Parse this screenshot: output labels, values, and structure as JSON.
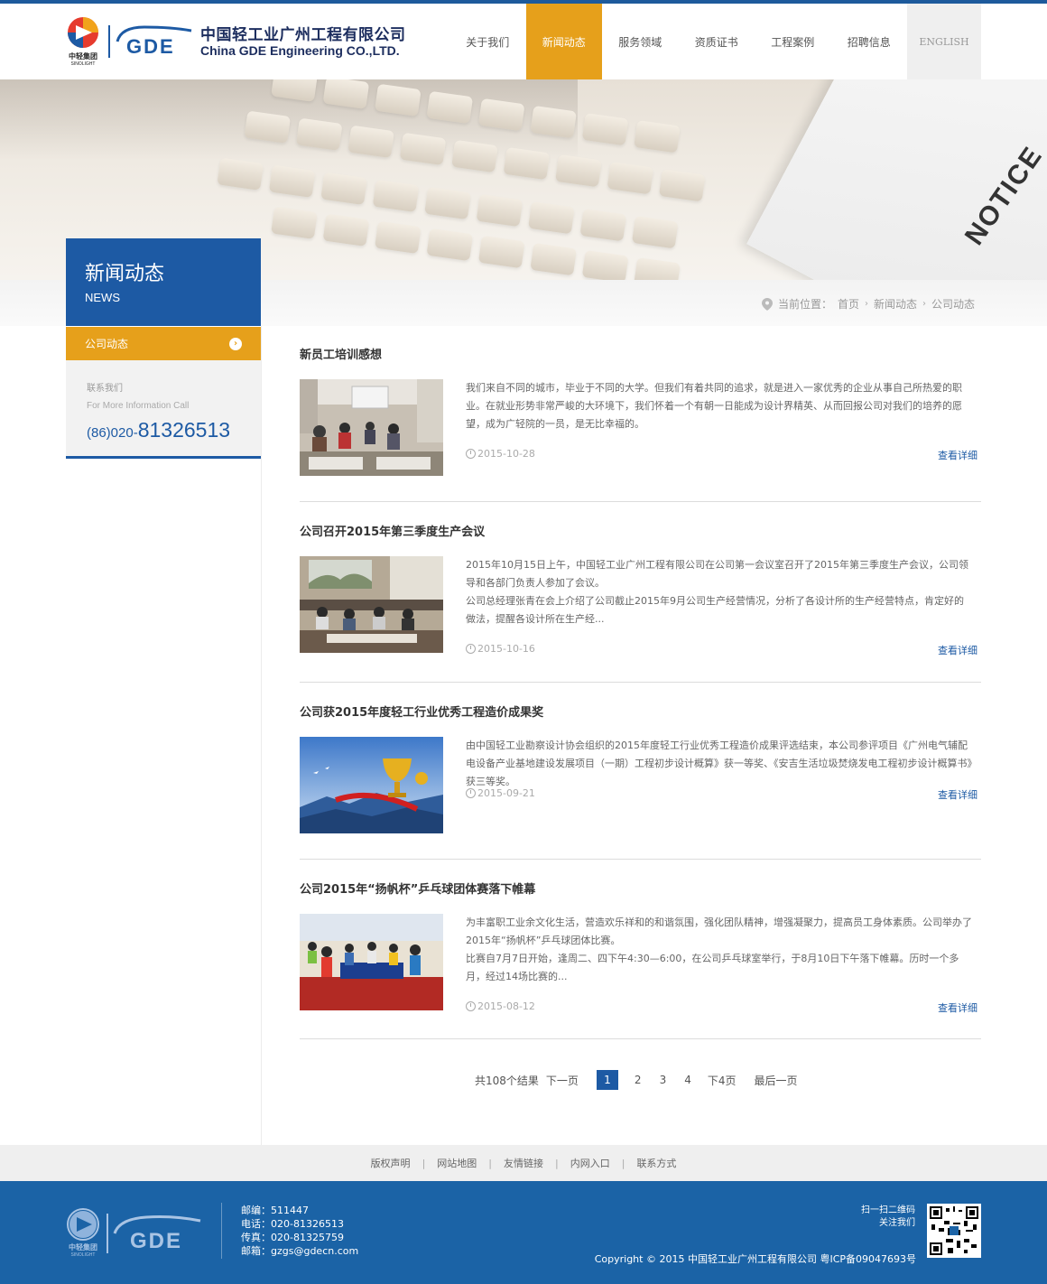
{
  "header": {
    "brand_group_cn": "中轻集团",
    "brand_group_en": "SINOLIGHT",
    "company_cn": "中国轻工业广州工程有限公司",
    "company_en": "China GDE Engineering CO.,LTD.",
    "logo_text": "GDE"
  },
  "nav": {
    "items": [
      {
        "label": "关于我们"
      },
      {
        "label": "新闻动态",
        "active": true
      },
      {
        "label": "服务领域"
      },
      {
        "label": "资质证书"
      },
      {
        "label": "工程案例"
      },
      {
        "label": "招聘信息"
      },
      {
        "label": "ENGLISH"
      }
    ]
  },
  "banner": {
    "notice_text": "NOTICE"
  },
  "breadcrumb": {
    "prefix": "当前位置：",
    "items": [
      "首页",
      "新闻动态",
      "公司动态"
    ]
  },
  "sidebar": {
    "title_cn": "新闻动态",
    "title_en": "NEWS",
    "menu_active": "公司动态",
    "contact_label": "联系我们",
    "contact_sub": "For More Information Call",
    "phone_prefix": "(86)020-",
    "phone_number": "81326513"
  },
  "news": [
    {
      "title": "新员工培训感想",
      "summary": "我们来自不同的城市，毕业于不同的大学。但我们有着共同的追求，就是进入一家优秀的企业从事自己所热爱的职业。在就业形势非常严峻的大环境下，我们怀着一个有朝一日能成为设计界精英、从而回报公司对我们的培养的愿望，成为广轻院的一员，是无比幸福的。",
      "date": "2015-10-28",
      "more": "查看详细"
    },
    {
      "title": "公司召开2015年第三季度生产会议",
      "summary": "2015年10月15日上午，中国轻工业广州工程有限公司在公司第一会议室召开了2015年第三季度生产会议，公司领导和各部门负责人参加了会议。",
      "summary2": "公司总经理张青在会上介绍了公司截止2015年9月公司生产经营情况，分析了各设计所的生产经营特点，肯定好的做法，提醒各设计所在生产经...",
      "date": "2015-10-16",
      "more": "查看详细"
    },
    {
      "title": "公司获2015年度轻工行业优秀工程造价成果奖",
      "summary": "由中国轻工业勘察设计协会组织的2015年度轻工行业优秀工程造价成果评选结束，本公司参评项目《广州电气辅配电设备产业基地建设发展项目（一期）工程初步设计概算》获一等奖、《安吉生活垃圾焚烧发电工程初步设计概算书》获三等奖。",
      "date": "2015-09-21",
      "more": "查看详细"
    },
    {
      "title": "公司2015年“扬帆杯”乒乓球团体赛落下帷幕",
      "summary": "为丰富职工业余文化生活，营造欢乐祥和的和谐氛围，强化团队精神，增强凝聚力，提高员工身体素质。公司举办了2015年“扬帆杯”乒乓球团体比赛。",
      "summary2": "比赛自7月7日开始，逢周二、四下午4:30—6:00，在公司乒乓球室举行，于8月10日下午落下帷幕。历时一个多月，经过14场比赛的...",
      "date": "2015-08-12",
      "more": "查看详细"
    }
  ],
  "pagination": {
    "total": "共108个结果",
    "prev": "下一页",
    "current": "1",
    "pages": [
      "2",
      "3",
      "4"
    ],
    "next4": "下4页",
    "last": "最后一页"
  },
  "footer_links": [
    "版权声明",
    "网站地图",
    "友情链接",
    "内网入口",
    "联系方式"
  ],
  "footer": {
    "postcode": "邮编：511447",
    "phone": "电话：020-81326513",
    "fax": "传真：020-81325759",
    "email": "邮箱：gzgs@gdecn.com",
    "qr_line1": "扫一扫二维码",
    "qr_line2": "关注我们",
    "copyright": "Copyright © 2015 中国轻工业广州工程有限公司 粤ICP备09047693号",
    "logo_cn": "中轻集团",
    "logo_en": "SINOLIGHT",
    "logo_text": "GDE"
  },
  "colors": {
    "brand_blue": "#1d5aa4",
    "accent_orange": "#e6a01b",
    "footer_blue": "#1b63a6"
  }
}
